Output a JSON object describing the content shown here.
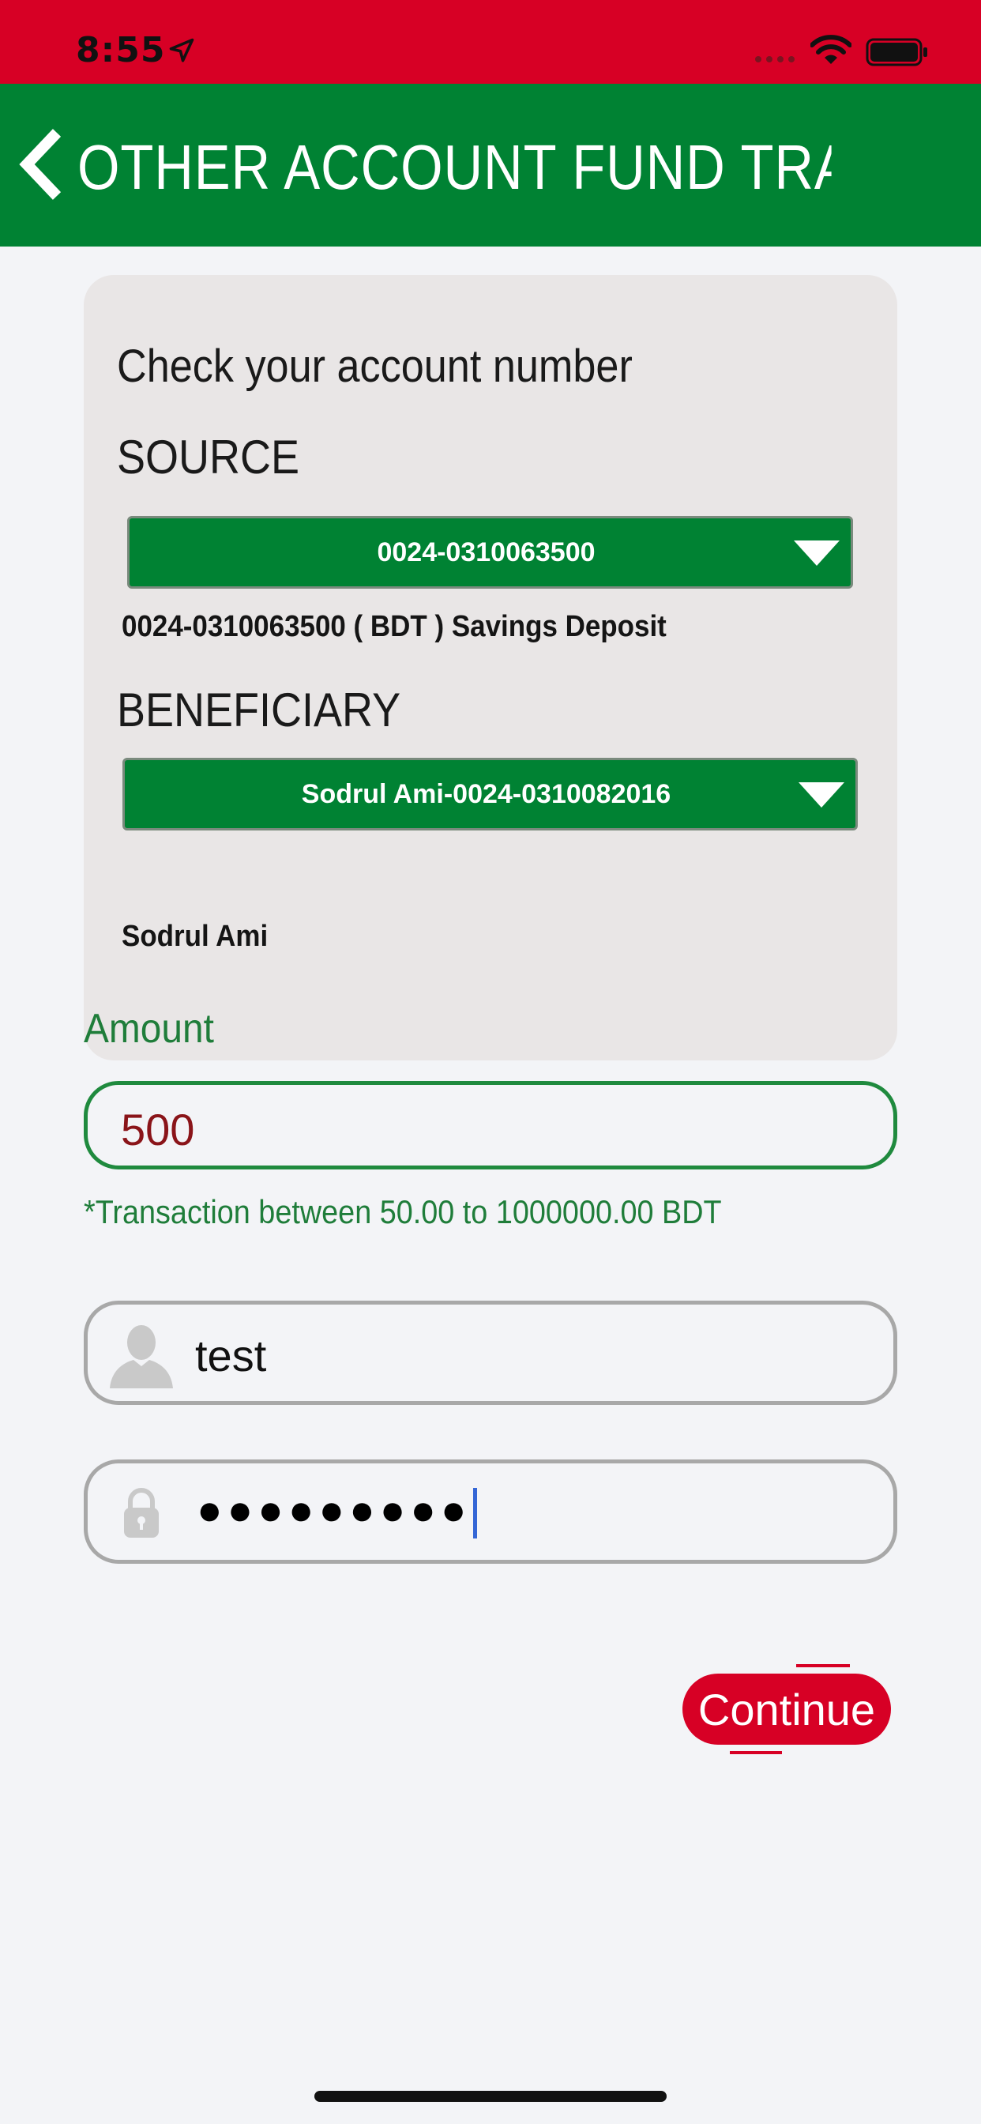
{
  "status_bar": {
    "time": "8:55"
  },
  "nav": {
    "title": "OTHER ACCOUNT FUND TRANS..."
  },
  "card": {
    "heading": "Check your account number",
    "source": {
      "label": "SOURCE",
      "selected": "0024-0310063500",
      "info": "0024-0310063500 ( BDT )  Savings Deposit"
    },
    "beneficiary": {
      "label": "BENEFICIARY",
      "selected": "Sodrul Ami-0024-0310082016",
      "name": "Sodrul Ami"
    }
  },
  "amount": {
    "label": "Amount",
    "value": "500",
    "note": "*Transaction between 50.00 to 1000000.00 BDT"
  },
  "username": {
    "value": "test",
    "icon": "user-icon"
  },
  "password": {
    "masked_value": "●●●●●●●●●",
    "icon": "lock-icon"
  },
  "actions": {
    "continue_label": "Continue"
  },
  "colors": {
    "brand_red": "#d70025",
    "brand_green": "#008233",
    "amount_text": "#8a1419"
  }
}
